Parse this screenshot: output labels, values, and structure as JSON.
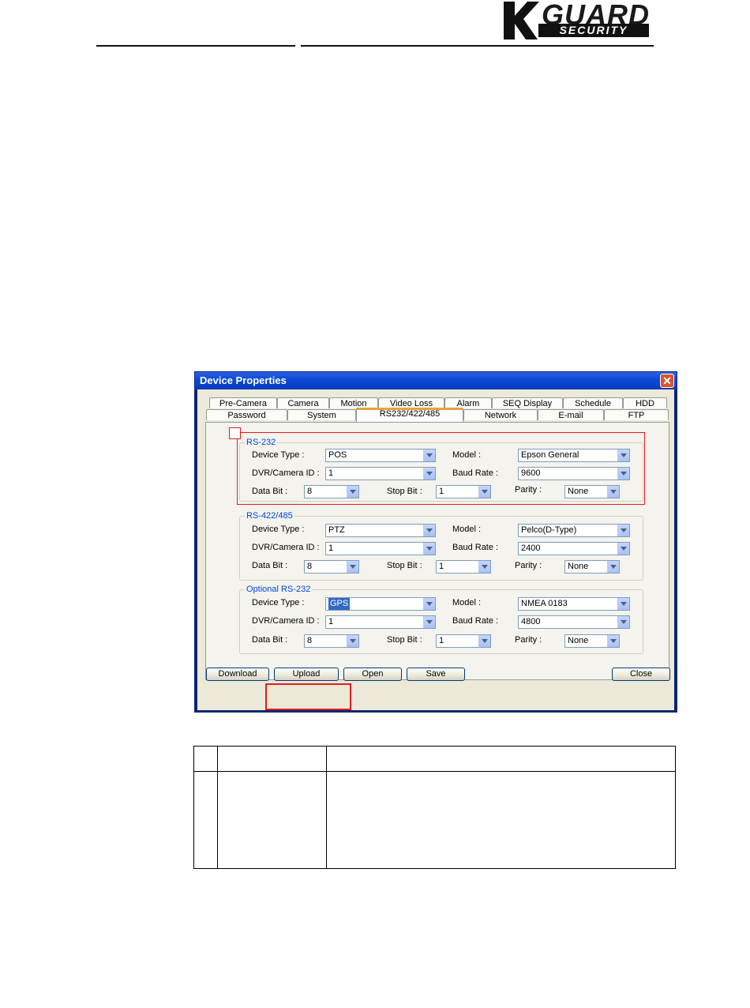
{
  "header": {
    "logo_k": "K",
    "logo_guard": "GUARD",
    "logo_security": "SECURITY"
  },
  "dialog": {
    "title": "Device Properties",
    "close_glyph": "✕",
    "tabs_row1": [
      "Pre-Camera",
      "Camera",
      "Motion",
      "Video Loss",
      "Alarm",
      "SEQ Display",
      "Schedule",
      "HDD"
    ],
    "tabs_row2": [
      "Password",
      "System",
      "RS232/422/485",
      "Network",
      "E-mail",
      "FTP"
    ],
    "active_tab": "RS232/422/485",
    "groups": [
      {
        "title": "RS-232",
        "device_type_label": "Device Type :",
        "device_type": "POS",
        "model_label": "Model :",
        "model": "Epson General",
        "camera_id_label": "DVR/Camera ID :",
        "camera_id": "1",
        "baud_label": "Baud Rate :",
        "baud": "9600",
        "data_bit_label": "Data Bit :",
        "data_bit": "8",
        "stop_bit_label": "Stop Bit :",
        "stop_bit": "1",
        "parity_label": "Parity :",
        "parity": "None"
      },
      {
        "title": "RS-422/485",
        "device_type_label": "Device Type :",
        "device_type": "PTZ",
        "model_label": "Model :",
        "model": "Pelco(D-Type)",
        "camera_id_label": "DVR/Camera ID :",
        "camera_id": "1",
        "baud_label": "Baud Rate :",
        "baud": "2400",
        "data_bit_label": "Data Bit :",
        "data_bit": "8",
        "stop_bit_label": "Stop Bit :",
        "stop_bit": "1",
        "parity_label": "Parity :",
        "parity": "None"
      },
      {
        "title": "Optional RS-232",
        "device_type_label": "Device Type :",
        "device_type": "GPS",
        "model_label": "Model :",
        "model": "NMEA 0183",
        "camera_id_label": "DVR/Camera ID :",
        "camera_id": "1",
        "baud_label": "Baud Rate :",
        "baud": "4800",
        "data_bit_label": "Data Bit :",
        "data_bit": "8",
        "stop_bit_label": "Stop Bit :",
        "stop_bit": "1",
        "parity_label": "Parity :",
        "parity": "None"
      }
    ],
    "buttons": {
      "download": "Download",
      "upload": "Upload",
      "open": "Open",
      "save": "Save",
      "close": "Close"
    }
  },
  "colors": {
    "highlight_red": "#e31d1d",
    "title_blue": "#0a4ad8",
    "group_title": "#0046d5"
  }
}
